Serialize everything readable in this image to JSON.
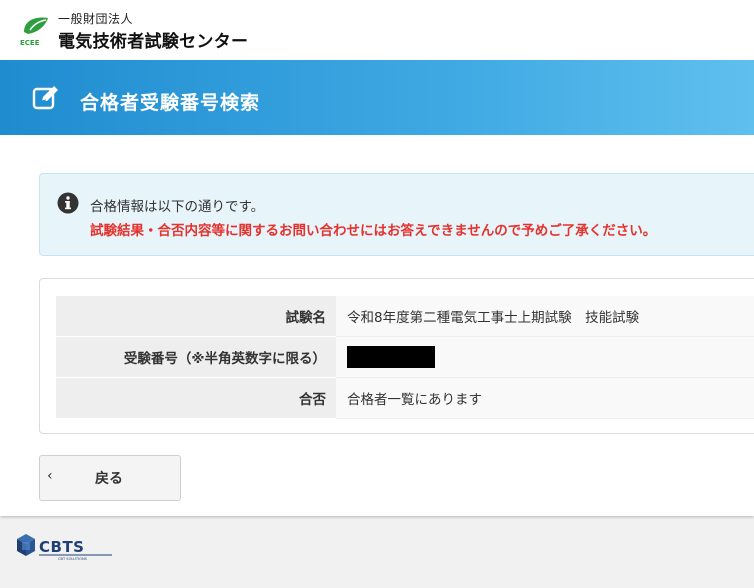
{
  "header": {
    "org_small": "一般財団法人",
    "org_large": "電気技術者試験センター",
    "logo_text": "ECEE"
  },
  "banner": {
    "title": "合格者受験番号検索",
    "icon": "edit-icon"
  },
  "info": {
    "icon": "info-icon",
    "line1": "合格情報は以下の通りです。",
    "line2": "試験結果・合否内容等に関するお問い合わせにはお答えできませんので予めご了承ください。"
  },
  "result": {
    "rows": [
      {
        "label": "試験名",
        "value": "令和8年度第二種電気工事士上期試験　技能試験"
      },
      {
        "label": "受験番号（※半角英数字に限る）",
        "value": ""
      },
      {
        "label": "合否",
        "value": "合格者一覧にあります"
      }
    ]
  },
  "back_button": {
    "label": "戻る",
    "chevron": "‹"
  },
  "footer": {
    "logo_text": "CBTS",
    "logo_subtext": "CBT SOLUTIONS"
  },
  "colors": {
    "banner_start": "#1f8cd0",
    "banner_end": "#5fc0ee",
    "warning_text": "#e5322d",
    "logo_green": "#2e9e3e"
  }
}
